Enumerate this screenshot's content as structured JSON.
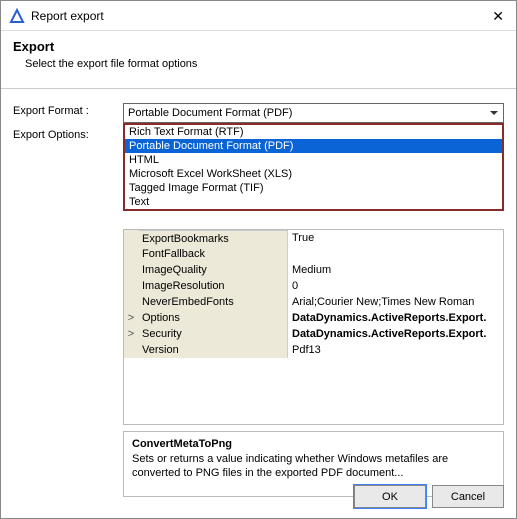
{
  "titlebar": {
    "title": "Report export"
  },
  "header": {
    "title": "Export",
    "subtitle": "Select the export file format options"
  },
  "labels": {
    "format": "Export Format :",
    "options": "Export Options:"
  },
  "combo": {
    "selected": "Portable Document Format (PDF)",
    "options": [
      "Rich Text Format (RTF)",
      "Portable Document Format (PDF)",
      "HTML",
      "Microsoft Excel WorkSheet (XLS)",
      "Tagged Image Format (TIF)",
      "Text"
    ],
    "highlight_index": 1
  },
  "grid": [
    {
      "exp": "",
      "name": "ExportBookmarks",
      "value": "True",
      "partial": true
    },
    {
      "exp": "",
      "name": "FontFallback",
      "value": ""
    },
    {
      "exp": "",
      "name": "ImageQuality",
      "value": "Medium"
    },
    {
      "exp": "",
      "name": "ImageResolution",
      "value": "0"
    },
    {
      "exp": "",
      "name": "NeverEmbedFonts",
      "value": "Arial;Courier New;Times New Roman"
    },
    {
      "exp": ">",
      "name": "Options",
      "value": "DataDynamics.ActiveReports.Export.",
      "bold": true
    },
    {
      "exp": ">",
      "name": "Security",
      "value": "DataDynamics.ActiveReports.Export.",
      "bold": true
    },
    {
      "exp": "",
      "name": "Version",
      "value": "Pdf13"
    }
  ],
  "desc": {
    "title": "ConvertMetaToPng",
    "text": "Sets or returns a value indicating whether Windows metafiles are converted to PNG files in the exported PDF document..."
  },
  "buttons": {
    "ok": "OK",
    "cancel": "Cancel"
  }
}
